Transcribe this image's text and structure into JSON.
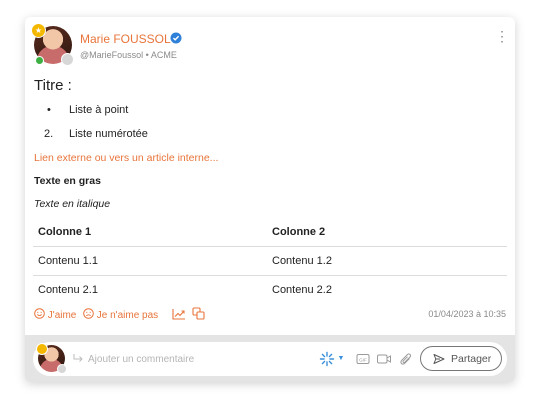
{
  "post": {
    "author": {
      "name": "Marie FOUSSOL",
      "handle": "@MarieFoussol",
      "separator": "•",
      "company": "ACME",
      "verified": true,
      "avatar": "avatar-photo",
      "status_color": "#3cb043",
      "badge_color": "#f5b800"
    },
    "menu_icon": "kebab-vertical-icon",
    "title": "Titre :",
    "bullet_list": [
      {
        "marker": "•",
        "text": "Liste à point"
      }
    ],
    "numbered_list": [
      {
        "marker": "2.",
        "text": "Liste numérotée"
      }
    ],
    "link_text": "Lien externe ou vers un article interne...",
    "bold_text": "Texte en gras",
    "italic_text": "Texte en italique",
    "table": {
      "headers": [
        "Colonne 1",
        "Colonne 2"
      ],
      "rows": [
        [
          "Contenu 1.1",
          "Contenu 1.2"
        ],
        [
          "Contenu 2.1",
          "Contenu 2.2"
        ]
      ]
    },
    "reactions": {
      "like_label": "J'aime",
      "like_icon": "smiley-icon",
      "dislike_label": "Je n'aime pas",
      "dislike_icon": "sad-face-icon",
      "stats_icon": "trend-chart-icon",
      "copy_icon": "copy-icon"
    },
    "timestamp": "01/04/2023 à 10:35",
    "accent_color": "#e8743b"
  },
  "comment": {
    "placeholder": "Ajouter un commentaire",
    "reply_icon": "reply-arrow-icon",
    "tools": [
      "ai-sparkle-icon",
      "gif-icon",
      "video-camera-icon",
      "paperclip-icon"
    ],
    "share_label": "Partager",
    "share_icon": "send-icon"
  }
}
